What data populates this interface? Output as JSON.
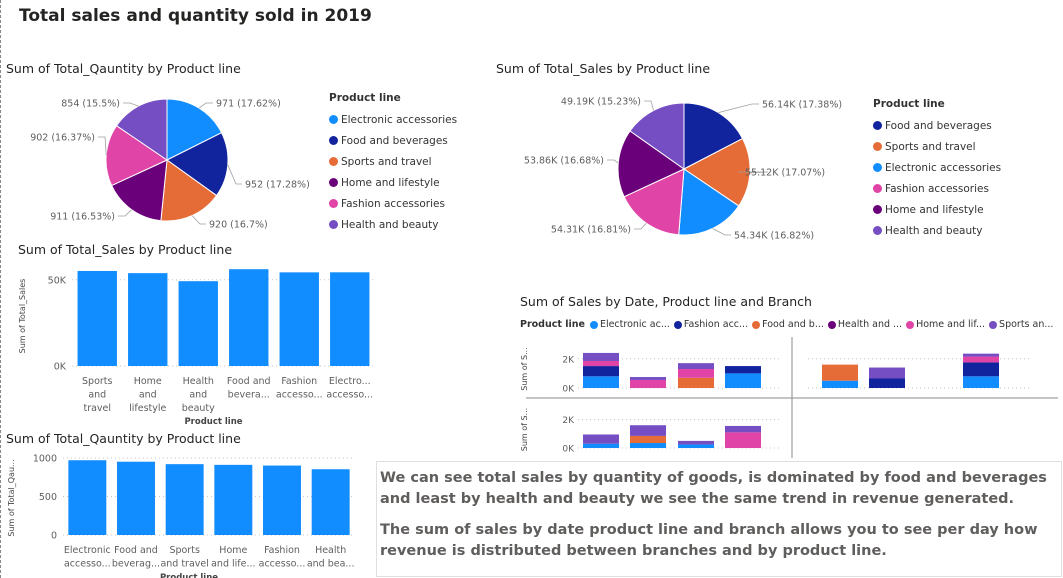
{
  "page": {
    "title": "Total sales and quantity sold in 2019",
    "textbox": {
      "paragraph1": "We can see total sales by quantity of goods, is dominated by food and beverages and least by health and beauty we see the same trend in revenue generated.",
      "paragraph2": "The sum of sales by date product line and branch allows you to see per day how revenue is distributed between branches and by product line."
    }
  },
  "colors": {
    "electronic": "#118DFF",
    "food": "#12239E",
    "sports": "#E66C37",
    "home": "#6B007B",
    "fashion": "#E044A7",
    "health": "#744EC2"
  },
  "chart_data": [
    {
      "id": "pie_qty",
      "type": "pie",
      "title": "Sum of Total_Qauntity by Product line",
      "legend_title": "Product line",
      "legend_position": "right",
      "slices": [
        {
          "name": "Electronic accessories",
          "value": 971,
          "label": "971 (17.62%)",
          "color": "#118DFF"
        },
        {
          "name": "Food and beverages",
          "value": 952,
          "label": "952 (17.28%)",
          "color": "#12239E"
        },
        {
          "name": "Sports and travel",
          "value": 920,
          "label": "920 (16.7%)",
          "color": "#E66C37"
        },
        {
          "name": "Home and lifestyle",
          "value": 911,
          "label": "911 (16.53%)",
          "color": "#6B007B"
        },
        {
          "name": "Fashion accessories",
          "value": 902,
          "label": "902 (16.37%)",
          "color": "#E044A7"
        },
        {
          "name": "Health and beauty",
          "value": 854,
          "label": "854 (15.5%)",
          "color": "#744EC2"
        }
      ]
    },
    {
      "id": "pie_sales",
      "type": "pie",
      "title": "Sum of Total_Sales by Product line",
      "legend_title": "Product line",
      "legend_position": "right",
      "slices": [
        {
          "name": "Food and beverages",
          "value": 56.14,
          "label": "56.14K (17.38%)",
          "color": "#12239E"
        },
        {
          "name": "Sports and travel",
          "value": 55.12,
          "label": "55.12K (17.07%)",
          "color": "#E66C37"
        },
        {
          "name": "Electronic accessories",
          "value": 54.34,
          "label": "54.34K (16.82%)",
          "color": "#118DFF"
        },
        {
          "name": "Fashion accessories",
          "value": 54.31,
          "label": "54.31K (16.81%)",
          "color": "#E044A7"
        },
        {
          "name": "Home and lifestyle",
          "value": 53.86,
          "label": "53.86K (16.68%)",
          "color": "#6B007B"
        },
        {
          "name": "Health and beauty",
          "value": 49.19,
          "label": "49.19K (15.23%)",
          "color": "#744EC2"
        }
      ]
    },
    {
      "id": "bar_sales",
      "type": "bar",
      "title": "Sum of Total_Sales by Product line",
      "xlabel": "Product line",
      "ylabel": "Sum of Total_Sales",
      "ylim": [
        0,
        58000
      ],
      "yticks": [
        {
          "value": 0,
          "label": "0K"
        },
        {
          "value": 50000,
          "label": "50K"
        }
      ],
      "grid": true,
      "categories": [
        [
          "Sports",
          "and",
          "travel"
        ],
        [
          "Home",
          "and",
          "lifestyle"
        ],
        [
          "Health",
          "and",
          "beauty"
        ],
        [
          "Food and",
          "bevera..."
        ],
        [
          "Fashion",
          "accesso..."
        ],
        [
          "Electro...",
          "accesso..."
        ]
      ],
      "values": [
        55120,
        53860,
        49190,
        56140,
        54310,
        54340
      ],
      "color": "#118DFF"
    },
    {
      "id": "bar_qty",
      "type": "bar",
      "title": "Sum of Total_Qauntity by Product line",
      "xlabel": "Product line",
      "ylabel": "Sum of Total_Qau...",
      "ylim": [
        0,
        1000
      ],
      "yticks": [
        {
          "value": 0,
          "label": "0"
        },
        {
          "value": 500,
          "label": "500"
        },
        {
          "value": 1000,
          "label": "1000"
        }
      ],
      "grid": true,
      "categories": [
        [
          "Electronic",
          "accesso..."
        ],
        [
          "Food and",
          "beverag..."
        ],
        [
          "Sports",
          "and travel"
        ],
        [
          "Home",
          "and life..."
        ],
        [
          "Fashion",
          "accesso..."
        ],
        [
          "Health",
          "and bea..."
        ]
      ],
      "values": [
        971,
        952,
        920,
        911,
        902,
        854
      ],
      "color": "#118DFF"
    },
    {
      "id": "small_multiples",
      "type": "bar",
      "title": "Sum of Sales by Date, Product line and Branch",
      "legend_title": "Product line",
      "legend_position": "top",
      "legend_items": [
        {
          "label": "Electronic ac...",
          "color": "#118DFF"
        },
        {
          "label": "Fashion acc...",
          "color": "#12239E"
        },
        {
          "label": "Food and b...",
          "color": "#E66C37"
        },
        {
          "label": "Health and ...",
          "color": "#6B007B"
        },
        {
          "label": "Home and lif...",
          "color": "#E044A7"
        },
        {
          "label": "Sports an...",
          "color": "#744EC2"
        }
      ],
      "ylabel": "Sum of S...",
      "ylim": [
        0,
        2600
      ],
      "yticks": [
        {
          "value": 0,
          "label": "0K"
        },
        {
          "value": 2000,
          "label": "2K"
        }
      ],
      "panels": [
        {
          "bars": [
            [
              {
                "c": "#118DFF",
                "v": 800
              },
              {
                "c": "#12239E",
                "v": 700
              },
              {
                "c": "#E044A7",
                "v": 350
              },
              {
                "c": "#744EC2",
                "v": 550
              }
            ],
            [
              {
                "c": "#E044A7",
                "v": 550
              },
              {
                "c": "#744EC2",
                "v": 200
              }
            ],
            [
              {
                "c": "#E66C37",
                "v": 700
              },
              {
                "c": "#E044A7",
                "v": 600
              },
              {
                "c": "#744EC2",
                "v": 400
              }
            ],
            [
              {
                "c": "#118DFF",
                "v": 1000
              },
              {
                "c": "#12239E",
                "v": 500
              }
            ]
          ]
        },
        {
          "bars": [
            [
              {
                "c": "#118DFF",
                "v": 500
              },
              {
                "c": "#E66C37",
                "v": 1100
              }
            ],
            [
              {
                "c": "#12239E",
                "v": 650
              },
              {
                "c": "#744EC2",
                "v": 750
              }
            ],
            [
              {
                "c": "#118DFF",
                "v": 800
              },
              {
                "c": "#12239E",
                "v": 950
              },
              {
                "c": "#E044A7",
                "v": 400
              },
              {
                "c": "#744EC2",
                "v": 200
              }
            ]
          ]
        },
        {
          "bars": [
            [
              {
                "c": "#118DFF",
                "v": 300
              },
              {
                "c": "#744EC2",
                "v": 650
              }
            ],
            [
              {
                "c": "#118DFF",
                "v": 350
              },
              {
                "c": "#E66C37",
                "v": 500
              },
              {
                "c": "#744EC2",
                "v": 750
              }
            ],
            [
              {
                "c": "#118DFF",
                "v": 250
              },
              {
                "c": "#744EC2",
                "v": 250
              }
            ],
            [
              {
                "c": "#E044A7",
                "v": 1100
              },
              {
                "c": "#744EC2",
                "v": 450
              }
            ]
          ]
        }
      ]
    }
  ]
}
